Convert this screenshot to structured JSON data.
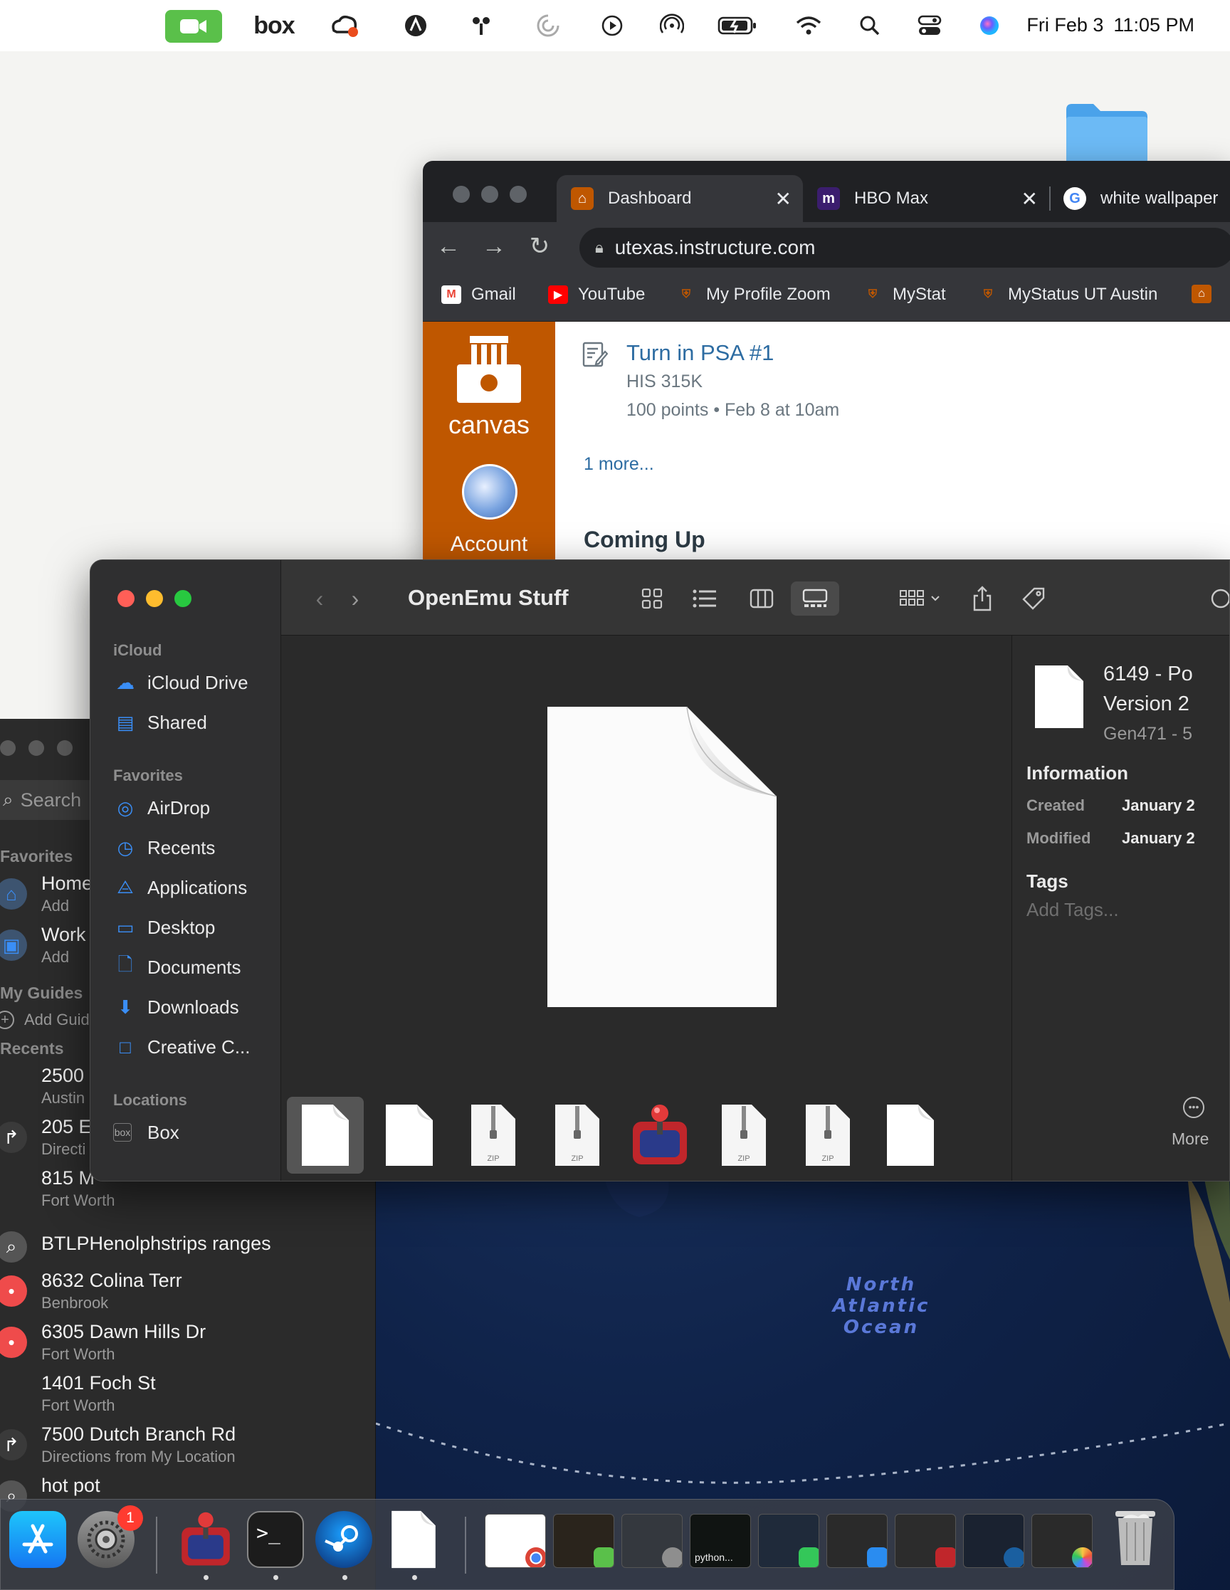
{
  "menubar": {
    "box_label": "box",
    "day_date": "Fri Feb 3",
    "time": "11:05 PM",
    "icons": [
      "facetime-icon",
      "box-icon",
      "creative-cloud-icon",
      "app-icon",
      "fan-icon",
      "loading-icon",
      "play-icon",
      "airdrop-icon",
      "battery-icon",
      "wifi-icon",
      "search-icon",
      "control-center-icon",
      "siri-icon"
    ]
  },
  "chrome": {
    "tabs": [
      {
        "label": "Dashboard",
        "favicon": "ut-tower-icon"
      },
      {
        "label": "HBO Max",
        "favicon": "max-icon"
      },
      {
        "label": "white wallpaper",
        "favicon": "google-icon"
      }
    ],
    "url": "utexas.instructure.com",
    "bookmarks": [
      {
        "label": "Gmail",
        "icon": "gmail-icon"
      },
      {
        "label": "YouTube",
        "icon": "youtube-icon"
      },
      {
        "label": "My Profile Zoom",
        "icon": "shield-icon"
      },
      {
        "label": "MyStat",
        "icon": "shield-icon"
      },
      {
        "label": "MyStatus UT Austin",
        "icon": "shield-icon"
      }
    ]
  },
  "canvas": {
    "logo_text": "canvas",
    "account_label": "Account",
    "todo": {
      "title": "Turn in PSA #1",
      "course": "HIS 315K",
      "meta": "100 points • Feb 8 at 10am"
    },
    "more_link": "1 more...",
    "coming_up": "Coming Up"
  },
  "finder": {
    "title": "OpenEmu Stuff",
    "sidebar": {
      "icloud_header": "iCloud",
      "icloud_items": [
        {
          "label": "iCloud Drive",
          "icon": "cloud-icon"
        },
        {
          "label": "Shared",
          "icon": "shared-folder-icon"
        }
      ],
      "favorites_header": "Favorites",
      "favorites_items": [
        {
          "label": "AirDrop",
          "icon": "airdrop-icon"
        },
        {
          "label": "Recents",
          "icon": "clock-icon"
        },
        {
          "label": "Applications",
          "icon": "applications-icon"
        },
        {
          "label": "Desktop",
          "icon": "desktop-icon"
        },
        {
          "label": "Documents",
          "icon": "document-icon"
        },
        {
          "label": "Downloads",
          "icon": "download-icon"
        },
        {
          "label": "Creative C...",
          "icon": "folder-icon"
        }
      ],
      "locations_header": "Locations",
      "locations_items": [
        {
          "label": "Box",
          "icon": "box-icon"
        }
      ]
    },
    "inspector": {
      "name_line1": "6149 - Po",
      "name_line2": "Version 2",
      "subtitle": "Gen471 - 5",
      "information_header": "Information",
      "created_label": "Created",
      "created_value": "January 2",
      "modified_label": "Modified",
      "modified_value": "January 2",
      "tags_header": "Tags",
      "add_tags_placeholder": "Add Tags...",
      "more_label": "More"
    },
    "zip_label": "ZIP",
    "thumbnails": [
      "document",
      "document",
      "zip",
      "zip",
      "openemu",
      "zip",
      "zip",
      "document"
    ]
  },
  "maps": {
    "search_placeholder": "Search",
    "favorites_header": "Favorites",
    "favorites": [
      {
        "title": "Home",
        "subtitle": "Add"
      },
      {
        "title": "Work",
        "subtitle": "Add"
      }
    ],
    "guides_header": "My Guides",
    "add_guide": "Add Guide",
    "recents_header": "Recents",
    "recents": [
      {
        "title": "2500",
        "subtitle": "Austin",
        "icon": "pin-icon"
      },
      {
        "title": "205 E",
        "subtitle": "Directi",
        "icon": "directions-icon"
      },
      {
        "title": "815 M",
        "subtitle": "Fort Worth",
        "icon": "pin-icon"
      },
      {
        "title": "BTLPHenolphstrips ranges",
        "subtitle": "",
        "icon": "search-icon"
      },
      {
        "title": "8632 Colina Terr",
        "subtitle": "Benbrook",
        "icon": "pin-icon"
      },
      {
        "title": "6305 Dawn Hills Dr",
        "subtitle": "Fort Worth",
        "icon": "pin-icon"
      },
      {
        "title": "1401 Foch St",
        "subtitle": "Fort Worth",
        "icon": "pin-icon"
      },
      {
        "title": "7500 Dutch Branch Rd",
        "subtitle": "Directions from My Location",
        "icon": "directions-icon"
      },
      {
        "title": "hot pot",
        "subtitle": "",
        "icon": "search-icon"
      }
    ],
    "ocean_label_1": "North",
    "ocean_label_2": "Atlantic",
    "ocean_label_3": "Ocean"
  },
  "dock": {
    "settings_badge": "1",
    "python_label": "python..."
  },
  "colors": {
    "ut_orange": "#bf5700",
    "canvas_link": "#2d6ca2",
    "finder_accent": "#3a8ef6",
    "close_red": "#ff5f57",
    "minimize_yellow": "#febc2e",
    "zoom_green": "#28c840"
  }
}
